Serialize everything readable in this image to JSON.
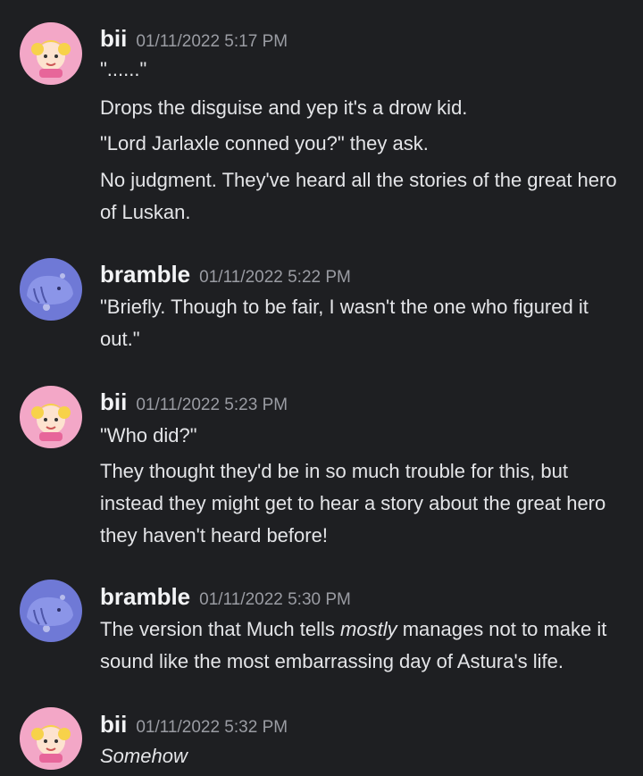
{
  "messages": [
    {
      "author": "bii",
      "time": "01/11/2022 5:17 PM",
      "lines": [
        "\"......\"",
        "Drops the disguise and yep it's a drow kid.",
        "\"Lord Jarlaxle conned you?\" they ask.",
        "No judgment. They've heard all the stories of the great hero of Luskan."
      ]
    },
    {
      "author": "bramble",
      "time": "01/11/2022 5:22 PM",
      "lines": [
        "\"Briefly. Though to be fair, I wasn't the one who figured it out.\""
      ]
    },
    {
      "author": "bii",
      "time": "01/11/2022 5:23 PM",
      "lines": [
        "\"Who did?\"",
        "They thought they'd be in so much trouble for this, but instead they might get to hear a story about the great hero they haven't heard before!"
      ]
    },
    {
      "author": "bramble",
      "time": "01/11/2022 5:30 PM",
      "line_before": "The version that Much tells ",
      "line_em": "mostly",
      "line_after": " manages not to make it sound like the most embarrassing day of Astura's life."
    },
    {
      "author": "bii",
      "time": "01/11/2022 5:32 PM",
      "lines": [
        "Somehow"
      ]
    }
  ],
  "colors": {
    "background": "#1e1f22",
    "text": "#e4e5e8",
    "timestamp": "#9a9ca3",
    "bii_avatar": "#f3a7c7",
    "bramble_avatar": "#6f79d6"
  },
  "icons": {
    "bii_avatar": "sailor-moon-chibi-avatar",
    "bramble_avatar": "blue-whale-avatar"
  }
}
